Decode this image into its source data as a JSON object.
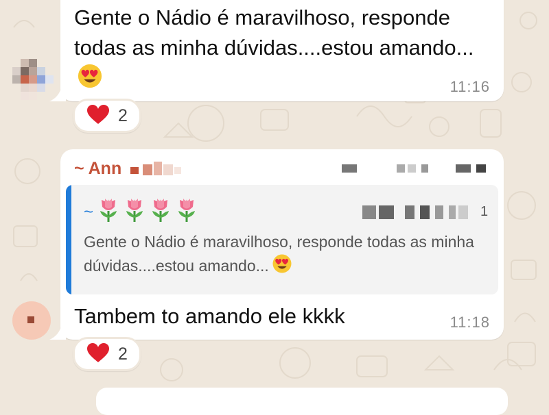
{
  "colors": {
    "wallpaper": "#efe7dc",
    "bubble": "#ffffff",
    "sender_name": "#c4533a",
    "quote_accent": "#1f7bd9",
    "timestamp": "#8a8a8a"
  },
  "messages": [
    {
      "text": "Gente o Nádio é maravilhoso, responde todas as minha dúvidas....estou amando...",
      "emoji": "heart-eyes-emoji",
      "time": "11:16",
      "reaction": {
        "emoji": "red-heart-emoji",
        "count": "2"
      }
    },
    {
      "sender": "~ Ann",
      "quoted": {
        "author_prefix": "~",
        "author_emoji": "tulip-emoji",
        "author_emoji_count": 4,
        "trailing_char": "1",
        "text": "Gente o Nádio é maravilhoso, responde todas as minha dúvidas....estou amando...",
        "emoji": "heart-eyes-emoji"
      },
      "text": "Tambem to amando ele kkkk",
      "time": "11:18",
      "reaction": {
        "emoji": "red-heart-emoji",
        "count": "2"
      }
    }
  ]
}
